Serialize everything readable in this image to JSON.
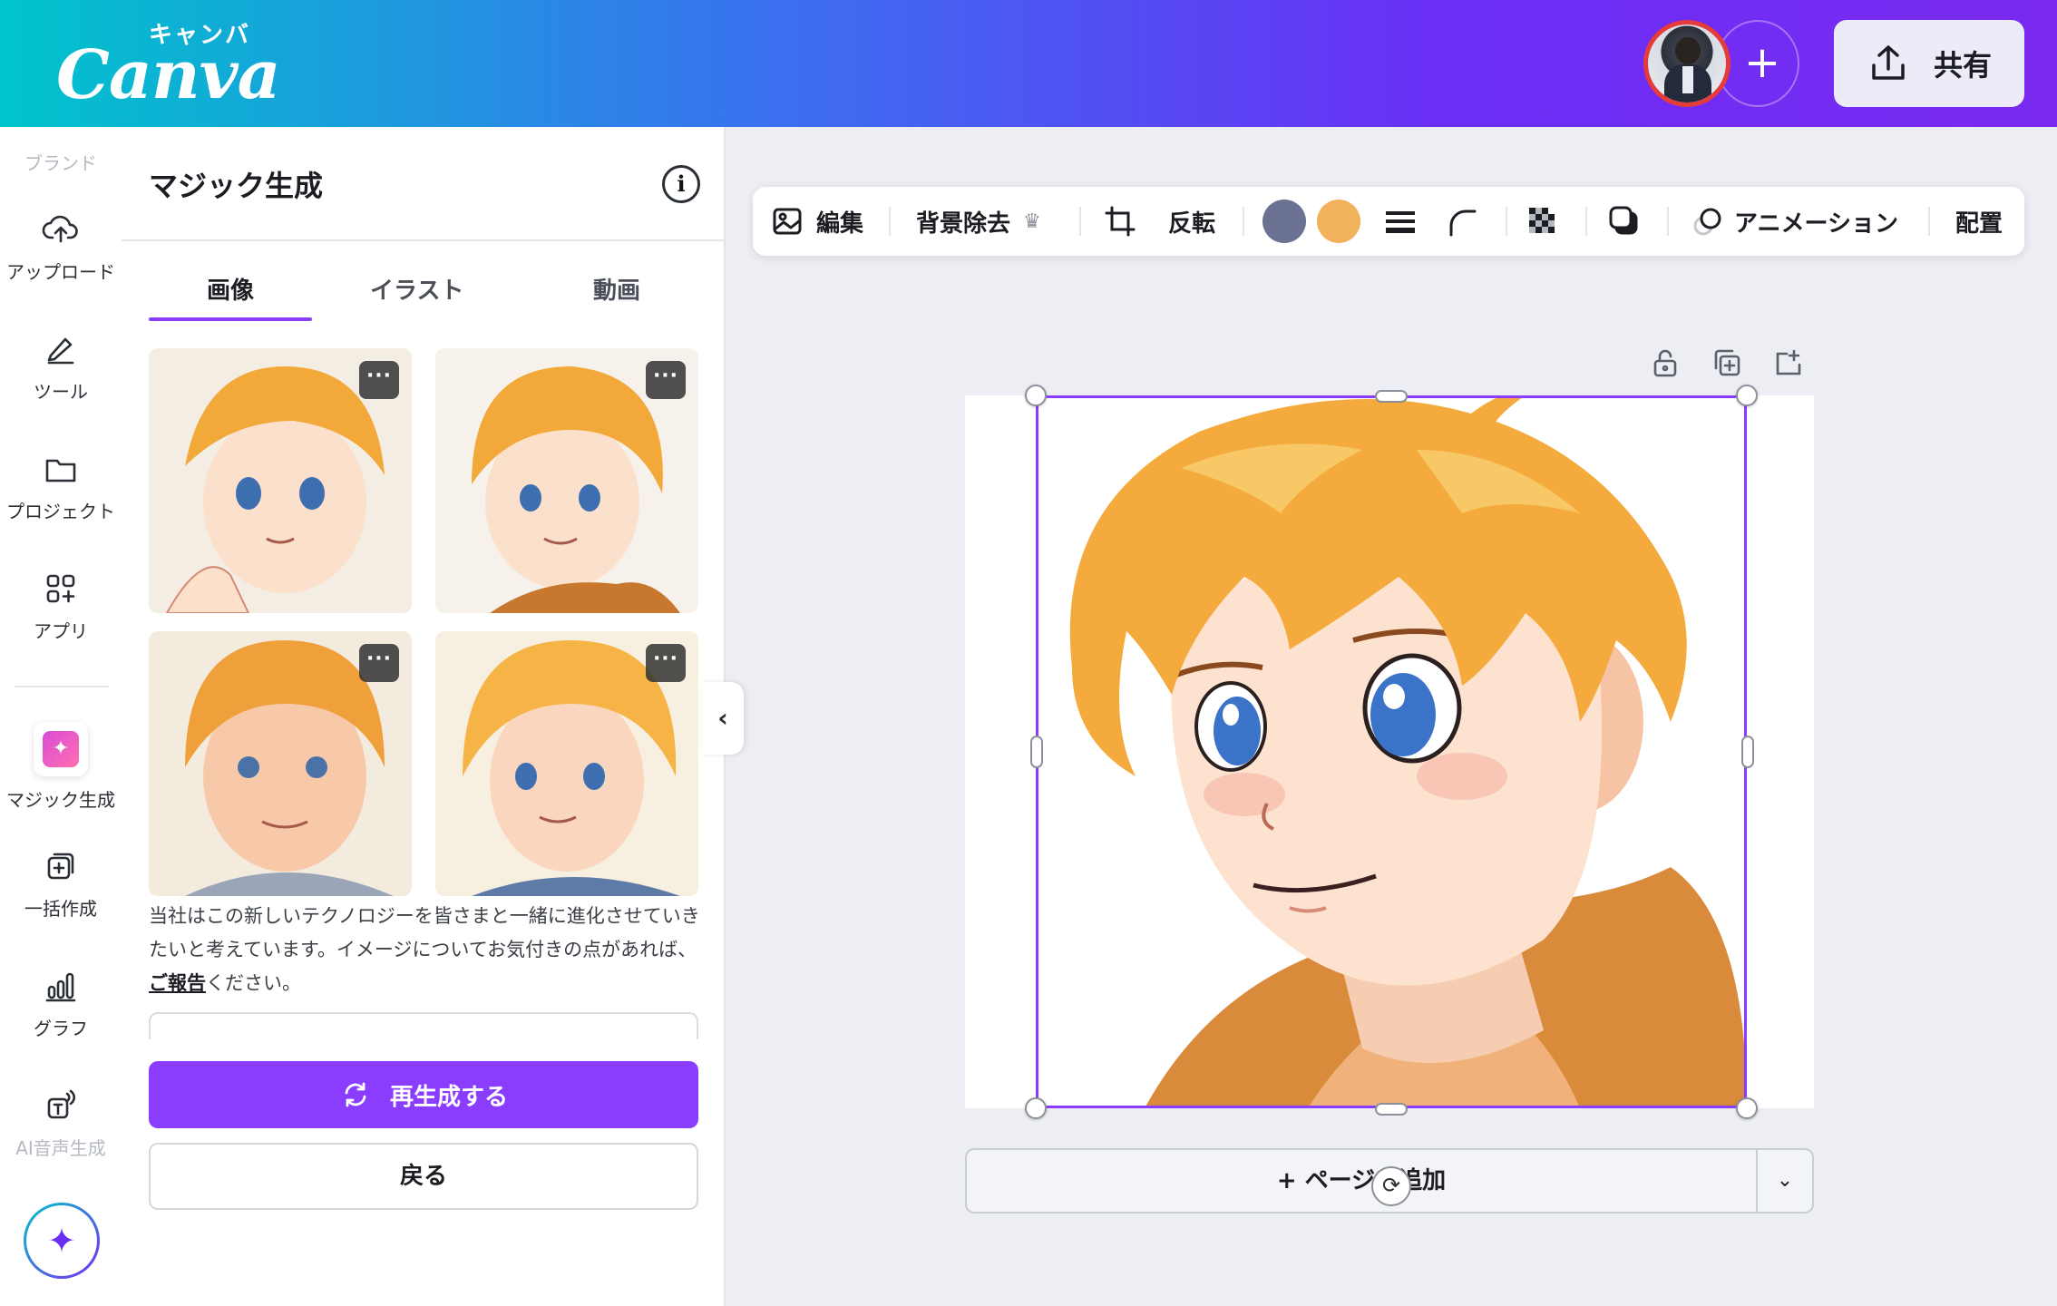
{
  "header": {
    "logo_word": "Canva",
    "logo_kana": "キャンバ",
    "add_collaborator": "+",
    "share_label": "共有"
  },
  "rail": {
    "items": [
      {
        "label": "ブランド",
        "icon": "brand-icon"
      },
      {
        "label": "アップロード",
        "icon": "upload-cloud-icon"
      },
      {
        "label": "ツール",
        "icon": "pen-tool-icon"
      },
      {
        "label": "プロジェクト",
        "icon": "folder-icon"
      },
      {
        "label": "アプリ",
        "icon": "apps-grid-icon"
      },
      {
        "label": "マジック生成",
        "icon": "magic-image-icon"
      },
      {
        "label": "一括作成",
        "icon": "bulk-create-icon"
      },
      {
        "label": "グラフ",
        "icon": "bar-chart-icon"
      },
      {
        "label": "AI音声生成",
        "icon": "ai-voice-icon"
      }
    ],
    "assistant_icon": "sparkle-icon"
  },
  "panel": {
    "title": "マジック生成",
    "tabs": [
      "画像",
      "イラスト",
      "動画"
    ],
    "active_tab": "画像",
    "result_more_label": "···",
    "disclaimer_before": "当社はこの新しいテクノロジーを皆さまと一緒に進化させていきたいと考えています。イメージについてお気付きの点があれば、",
    "disclaimer_link": "ご報告",
    "disclaimer_after": "ください。",
    "regenerate_label": "再生成する",
    "back_label": "戻る",
    "collapse_label": "‹"
  },
  "toolbar": {
    "edit": "編集",
    "remove_bg": "背景除去",
    "flip": "反転",
    "animate": "アニメーション",
    "position": "配置",
    "swatches": [
      "#6b7190",
      "#f2b25c"
    ]
  },
  "canvas": {
    "add_page_label": "+ ページを追加",
    "add_page_caret": "⌄",
    "rotate_label": "⟳"
  }
}
